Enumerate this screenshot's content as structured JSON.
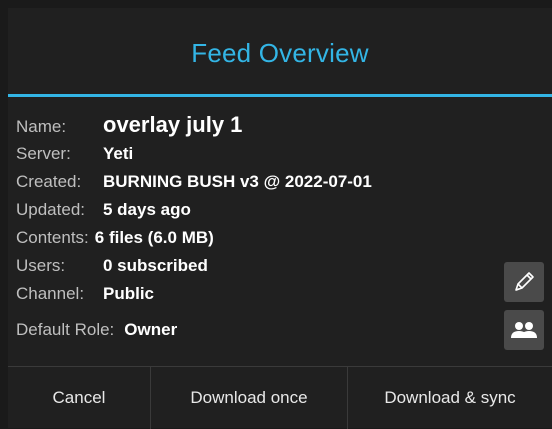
{
  "dialog": {
    "title": "Feed Overview"
  },
  "info": {
    "name_label": "Name:",
    "name_value": "overlay july 1",
    "server_label": "Server:",
    "server_value": "Yeti",
    "created_label": "Created:",
    "created_value": "BURNING BUSH v3 @ 2022-07-01",
    "updated_label": "Updated:",
    "updated_value": "5 days ago",
    "contents_label": "Contents:",
    "contents_value": "6 files (6.0 MB)",
    "users_label": "Users:",
    "users_value": "0 subscribed",
    "channel_label": "Channel:",
    "channel_value": "Public",
    "role_label": "Default Role:",
    "role_value": "Owner"
  },
  "side_buttons": {
    "edit_icon": "pencil-icon",
    "users_icon": "users-icon"
  },
  "footer": {
    "cancel_label": "Cancel",
    "download_once_label": "Download once",
    "download_sync_label": "Download & sync"
  },
  "colors": {
    "accent": "#33b5e5",
    "background": "#202020",
    "button_bg": "#4a4a4a"
  }
}
